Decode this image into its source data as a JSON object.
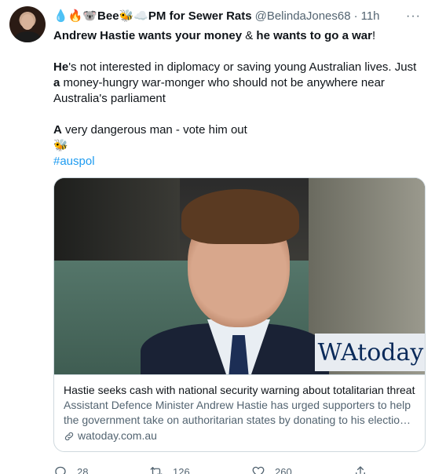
{
  "tweet": {
    "display_name": "💧🔥🐨Bee🐝☁️PM for Sewer Rats",
    "handle": "@BelindaJones68",
    "separator": "·",
    "time": "11h",
    "more_label": "···",
    "lines": [
      {
        "parts": [
          {
            "text": "Andrew Hastie wants your money",
            "bold": true
          },
          {
            "text": " & ",
            "bold": false
          },
          {
            "text": "he wants to go a war",
            "bold": true
          },
          {
            "text": "!",
            "bold": false
          }
        ]
      },
      {
        "parts": []
      },
      {
        "parts": [
          {
            "text": "He",
            "bold": true
          },
          {
            "text": "'s not interested in diplomacy or saving young Australian lives. Just ",
            "bold": false
          },
          {
            "text": "a",
            "bold": true
          },
          {
            "text": " money-hungry war-monger who should not be anywhere near Australia's parliament",
            "bold": false
          }
        ]
      },
      {
        "parts": []
      },
      {
        "parts": [
          {
            "text": "A",
            "bold": true
          },
          {
            "text": " very dangerous man - vote him out",
            "bold": false
          }
        ]
      },
      {
        "parts": [
          {
            "text": "🐝",
            "bold": false
          }
        ]
      }
    ],
    "hashtag": "#auspol"
  },
  "card": {
    "brand_text": "WAtoday",
    "title": "Hastie seeks cash with national security warning about totalitarian threat",
    "description": "Assistant Defence Minister Andrew Hastie has urged supporters to help the government take on authoritarian states by donating to his electio…",
    "domain": "watoday.com.au"
  },
  "actions": {
    "reply_count": "28",
    "retweet_count": "126",
    "like_count": "260"
  },
  "colors": {
    "accent": "#1d9bf0",
    "secondary_text": "#536471",
    "border": "#cfd9de"
  }
}
